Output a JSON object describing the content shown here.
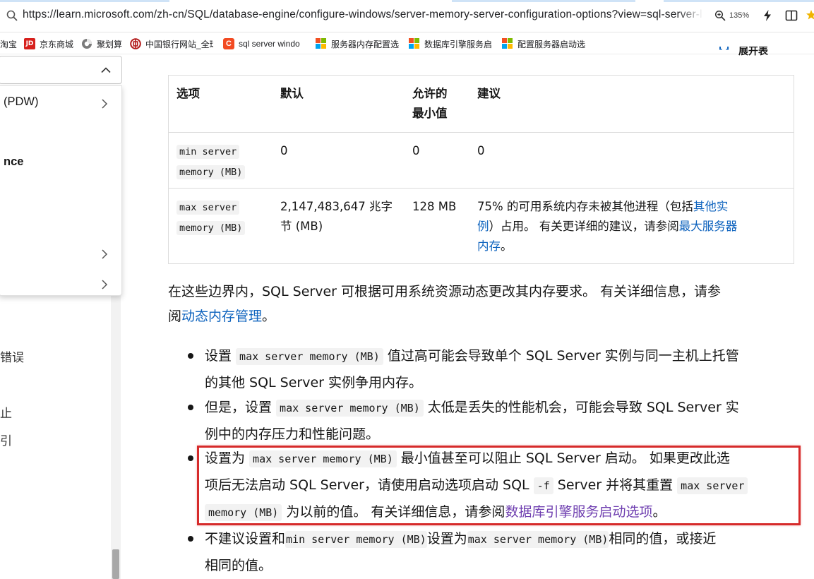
{
  "browser": {
    "url": "https://learn.microsoft.com/zh-cn/SQL/database-engine/configure-windows/server-memory-server-configuration-options?view=sql-server-linux",
    "zoom": "135%",
    "colors": {
      "accent": "#0e63be",
      "highlight_box": "#d62b2b"
    },
    "icons": [
      "search-icon",
      "zoom-icon",
      "bolt-icon",
      "reader-mode-icon",
      "star-icon"
    ]
  },
  "bookmarks": [
    {
      "label": "淘宝",
      "icon": "taobao-icon"
    },
    {
      "label": "京东商城",
      "icon": "jd-icon",
      "badge": "JD"
    },
    {
      "label": "聚划算",
      "icon": "juhuasuan-icon"
    },
    {
      "label": "中国银行网站_全球",
      "icon": "boc-icon"
    },
    {
      "label": "sql server windo",
      "icon": "csdn-icon",
      "badge": "C"
    },
    {
      "label": "服务器内存配置选",
      "icon": "microsoft-icon"
    },
    {
      "label": "数据库引擎服务启",
      "icon": "microsoft-icon"
    },
    {
      "label": "配置服务器启动选",
      "icon": "microsoft-icon"
    }
  ],
  "leftnav": {
    "dropdown_items": [
      {
        "label": "(PDW)",
        "has_chevron": true
      },
      {
        "label": "nce",
        "has_chevron": false
      },
      {
        "label": "",
        "has_chevron": true
      },
      {
        "label": "",
        "has_chevron": true
      }
    ],
    "background_items": [
      "错误",
      "止",
      "引"
    ]
  },
  "toc_remnant": "展开表",
  "table": {
    "headers": [
      "选项",
      "默认",
      "允许的最小值",
      "建议"
    ],
    "header_min_line1": "允许的",
    "header_min_line2": "最小值",
    "rows": [
      {
        "option_line1": "min server",
        "option_line2": "memory (MB)",
        "default": "0",
        "minimum": "0",
        "recommendation": "0"
      },
      {
        "option_line1": "max server",
        "option_line2": "memory (MB)",
        "default_line1": "2,147,483,647 兆字",
        "default_line2": "节 (MB)",
        "minimum": "128 MB",
        "rec_part1": "75% 的可用系统内存未被其他进程（包括",
        "rec_link1": "其他实",
        "rec_link1b": "例",
        "rec_part2": "）占用。 有关更详细的建议，请参阅",
        "rec_link2a": "最大服务器",
        "rec_link2b": "内存",
        "rec_part3": "。"
      }
    ]
  },
  "paragraph": {
    "line1": "在这些边界内，SQL Server 可根据可用系统资源动态更改其内存要求。 有关详细信息，请参",
    "line2_prefix": "阅",
    "link": "动态内存管理",
    "line2_suffix": "。"
  },
  "bullets": [
    {
      "pre": "设置 ",
      "code": "max server memory (MB)",
      "post1": " 值过高可能会导致单个 SQL Server 实例与同一主机上托管",
      "line2": "的其他 SQL Server 实例争用内存。"
    },
    {
      "pre": "但是，设置 ",
      "code": "max server memory (MB)",
      "post1": " 太低是丢失的性能机会，可能会导致 SQL Server 实",
      "line2": "例中的内存压力和性能问题。"
    },
    {
      "pre": "设置为 ",
      "code": "max server memory (MB)",
      "post1": " 最小值甚至可以阻止 SQL Server 启动。 如果更改此选",
      "line2_pre": "项后无法启动 SQL Server，请使用启动选项启动 SQL ",
      "code2": "-f",
      "line2_mid": " Server 并将其重置 ",
      "code3a": "max server",
      "code3b": "memory (MB)",
      "line3_mid": " 为以前的值。 有关详细信息，请参阅",
      "link": "数据库引擎服务启动选项",
      "line3_end": "。"
    },
    {
      "pre": "不建议设置和",
      "code": "min server memory (MB)",
      "mid": "设置为",
      "code2": "max server memory (MB)",
      "post1": "相同的值，或接近",
      "line2": "相同的值。"
    }
  ]
}
